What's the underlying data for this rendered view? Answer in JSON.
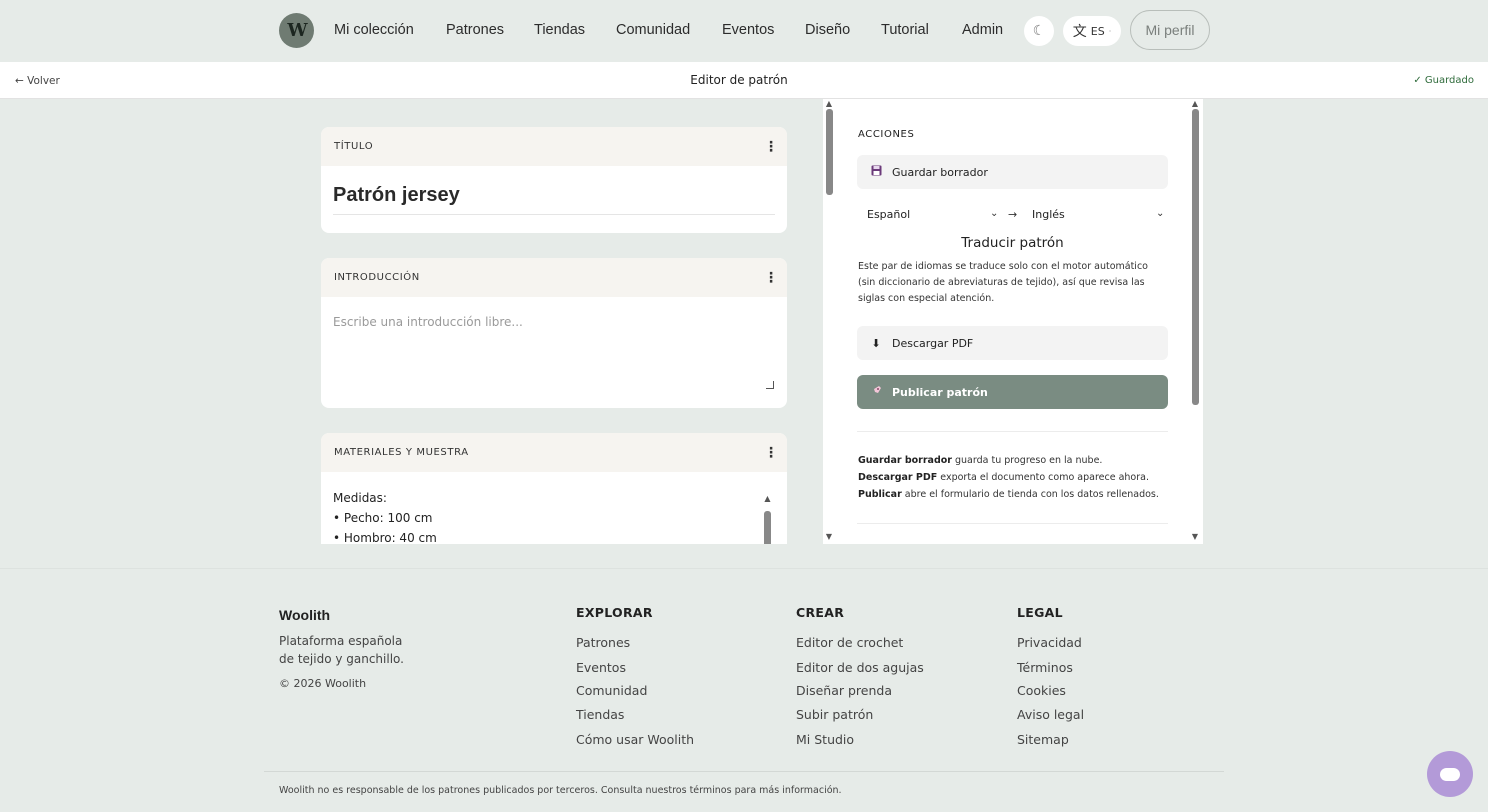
{
  "header": {
    "logo_text": "W",
    "nav": [
      "Mi colección",
      "Patrones",
      "Tiendas",
      "Comunidad",
      "Eventos",
      "Diseño",
      "Tutorial",
      "Admin"
    ],
    "theme_icon": "moon-icon",
    "lang_glyph": "文",
    "lang_code": "ES",
    "lang_caret": "·",
    "profile_label": "Mi perfil"
  },
  "editor_bar": {
    "back_label": "← Volver",
    "title": "Editor de patrón",
    "saved_label": "✓ Guardado"
  },
  "sections": {
    "title": {
      "header": "TÍTULO",
      "value": "Patrón jersey"
    },
    "intro": {
      "header": "INTRODUCCIÓN",
      "placeholder": "Escribe una introducción libre..."
    },
    "materials": {
      "header": "MATERIALES Y MUESTRA",
      "lines": [
        "Medidas:",
        "• Pecho: 100 cm",
        "• Hombro: 40 cm"
      ]
    },
    "kebab_glyph": "⋮"
  },
  "actions": {
    "heading": "ACCIONES",
    "save_draft": "Guardar borrador",
    "source_lang": "Español",
    "target_lang": "Inglés",
    "lang_arrow": "→",
    "translate_label": "Traducir patrón",
    "translate_note": "Este par de idiomas se traduce solo con el motor automático (sin diccionario de abreviaturas de tejido), así que revisa las siglas con especial atención.",
    "download_pdf": "Descargar PDF",
    "publish": "Publicar patrón",
    "help": [
      {
        "bold": "Guardar borrador",
        "text": " guarda tu progreso en la nube."
      },
      {
        "bold": "Descargar PDF",
        "text": " exporta el documento como aparece ahora."
      },
      {
        "bold": "Publicar",
        "text": " abre el formulario de tienda con los datos rellenados."
      }
    ]
  },
  "footer": {
    "brand": "Woolith",
    "tagline": "Plataforma española de tejido y ganchillo.",
    "copyright": "© 2026 Woolith",
    "columns": [
      {
        "title": "EXPLORAR",
        "links": [
          "Patrones",
          "Eventos",
          "Comunidad",
          "Tiendas",
          "Cómo usar Woolith"
        ]
      },
      {
        "title": "CREAR",
        "links": [
          "Editor de crochet",
          "Editor de dos agujas",
          "Diseñar prenda",
          "Subir patrón",
          "Mi Studio"
        ]
      },
      {
        "title": "LEGAL",
        "links": [
          "Privacidad",
          "Términos",
          "Cookies",
          "Aviso legal",
          "Sitemap"
        ]
      }
    ],
    "disclaimer": "Woolith no es responsable de los patrones publicados por terceros. Consulta nuestros términos para más información."
  },
  "colors": {
    "page_bg": "#e6ebe8",
    "publish_bg": "#7a8c82",
    "saved_green": "#2f6b3b",
    "chat_fab": "#b39ad8"
  }
}
